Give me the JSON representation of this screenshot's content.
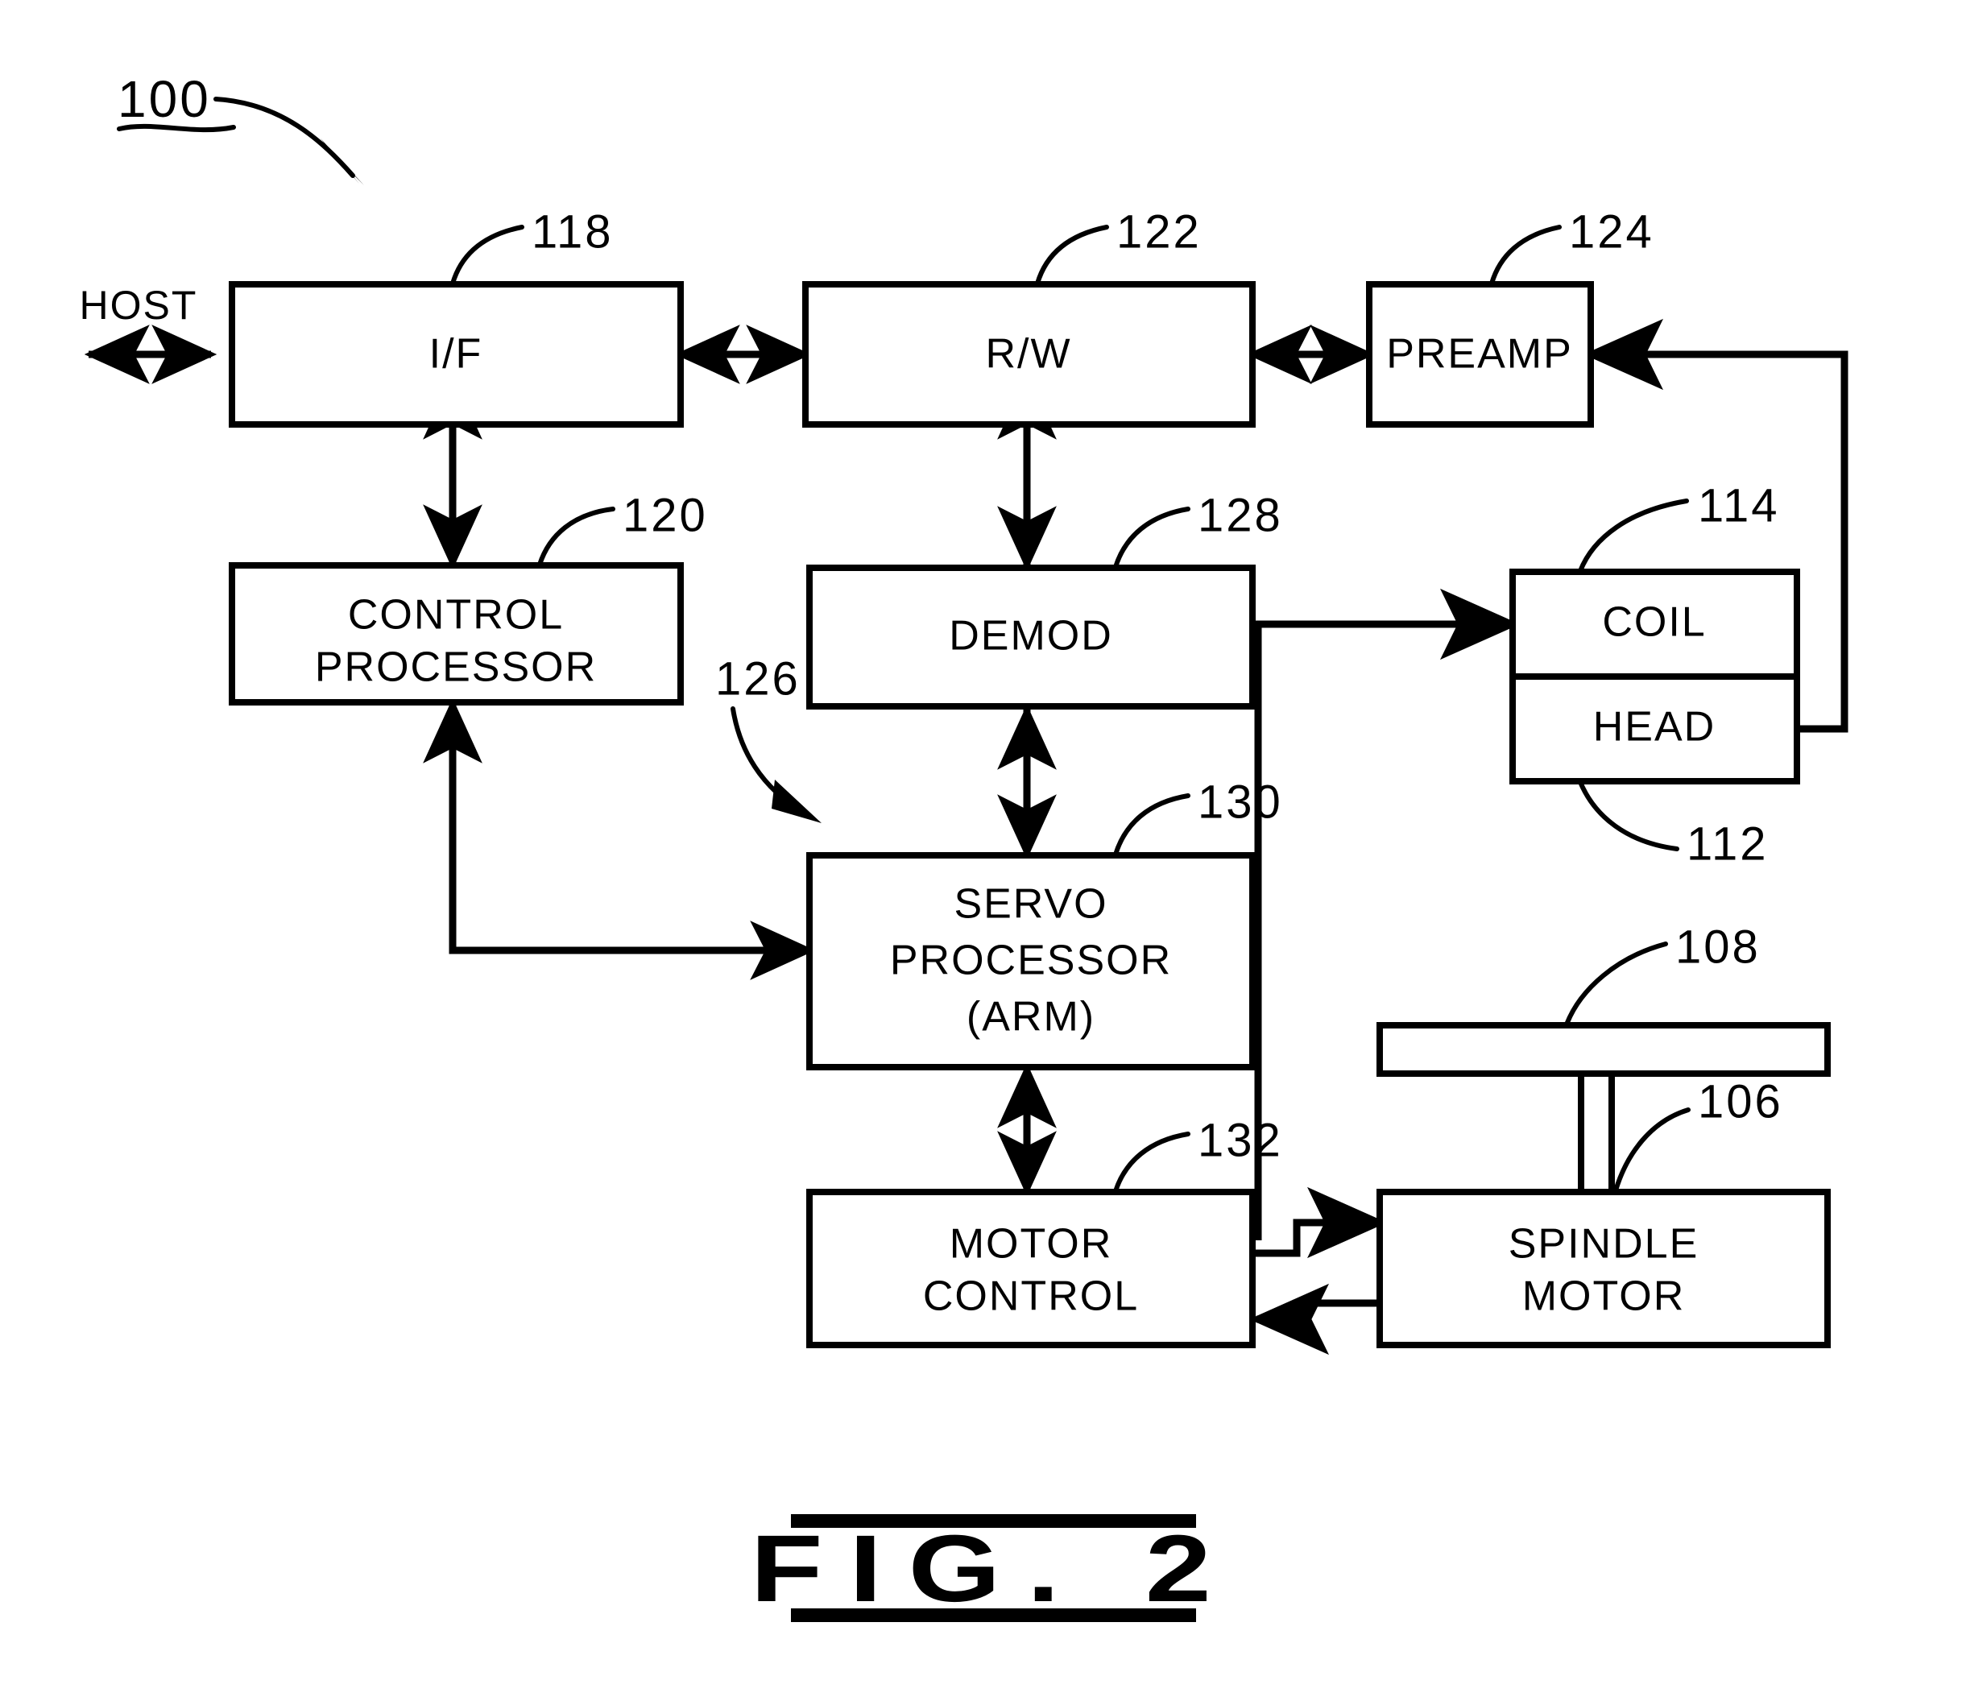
{
  "figure": {
    "caption": "FIG. 2",
    "system_ref": "100",
    "host_label": "HOST"
  },
  "blocks": [
    {
      "id": "if",
      "label": "I/F",
      "ref": "118"
    },
    {
      "id": "rw",
      "label": "R/W",
      "ref": "122"
    },
    {
      "id": "preamp",
      "label": "PREAMP",
      "ref": "124"
    },
    {
      "id": "ctrl",
      "label": "CONTROL\nPROCESSOR",
      "ref": "120"
    },
    {
      "id": "demod",
      "label": "DEMOD",
      "ref": "128"
    },
    {
      "id": "servo",
      "label": "SERVO\nPROCESSOR\n(ARM)",
      "ref": "130"
    },
    {
      "id": "motor",
      "label": "MOTOR\nCONTROL",
      "ref": "132"
    },
    {
      "id": "coil",
      "label": "COIL",
      "ref": "114"
    },
    {
      "id": "head",
      "label": "HEAD",
      "ref": "112"
    },
    {
      "id": "spindle",
      "label": "SPINDLE\nMOTOR",
      "ref": "106"
    },
    {
      "id": "disc",
      "label": "",
      "ref": "108"
    }
  ],
  "labels": {
    "if_line1": "I/F",
    "rw_line1": "R/W",
    "preamp_line1": "PREAMP",
    "control_line1": "CONTROL",
    "control_line2": "PROCESSOR",
    "demod_line1": "DEMOD",
    "servo_line1": "SERVO",
    "servo_line2": "PROCESSOR",
    "servo_line3": "(ARM)",
    "motor_line1": "MOTOR",
    "motor_line2": "CONTROL",
    "coil_line1": "COIL",
    "head_line1": "HEAD",
    "spindle_line1": "SPINDLE",
    "spindle_line2": "MOTOR",
    "host": "HOST"
  },
  "refs": {
    "system": "100",
    "interface": "118",
    "read_write": "122",
    "preamp": "124",
    "control_processor": "120",
    "demod": "128",
    "servo_channel": "126",
    "servo_processor": "130",
    "motor_control": "132",
    "coil": "114",
    "head": "112",
    "disc": "108",
    "spindle_motor": "106"
  },
  "colors": {
    "ink": "#000000",
    "paper": "#ffffff"
  }
}
